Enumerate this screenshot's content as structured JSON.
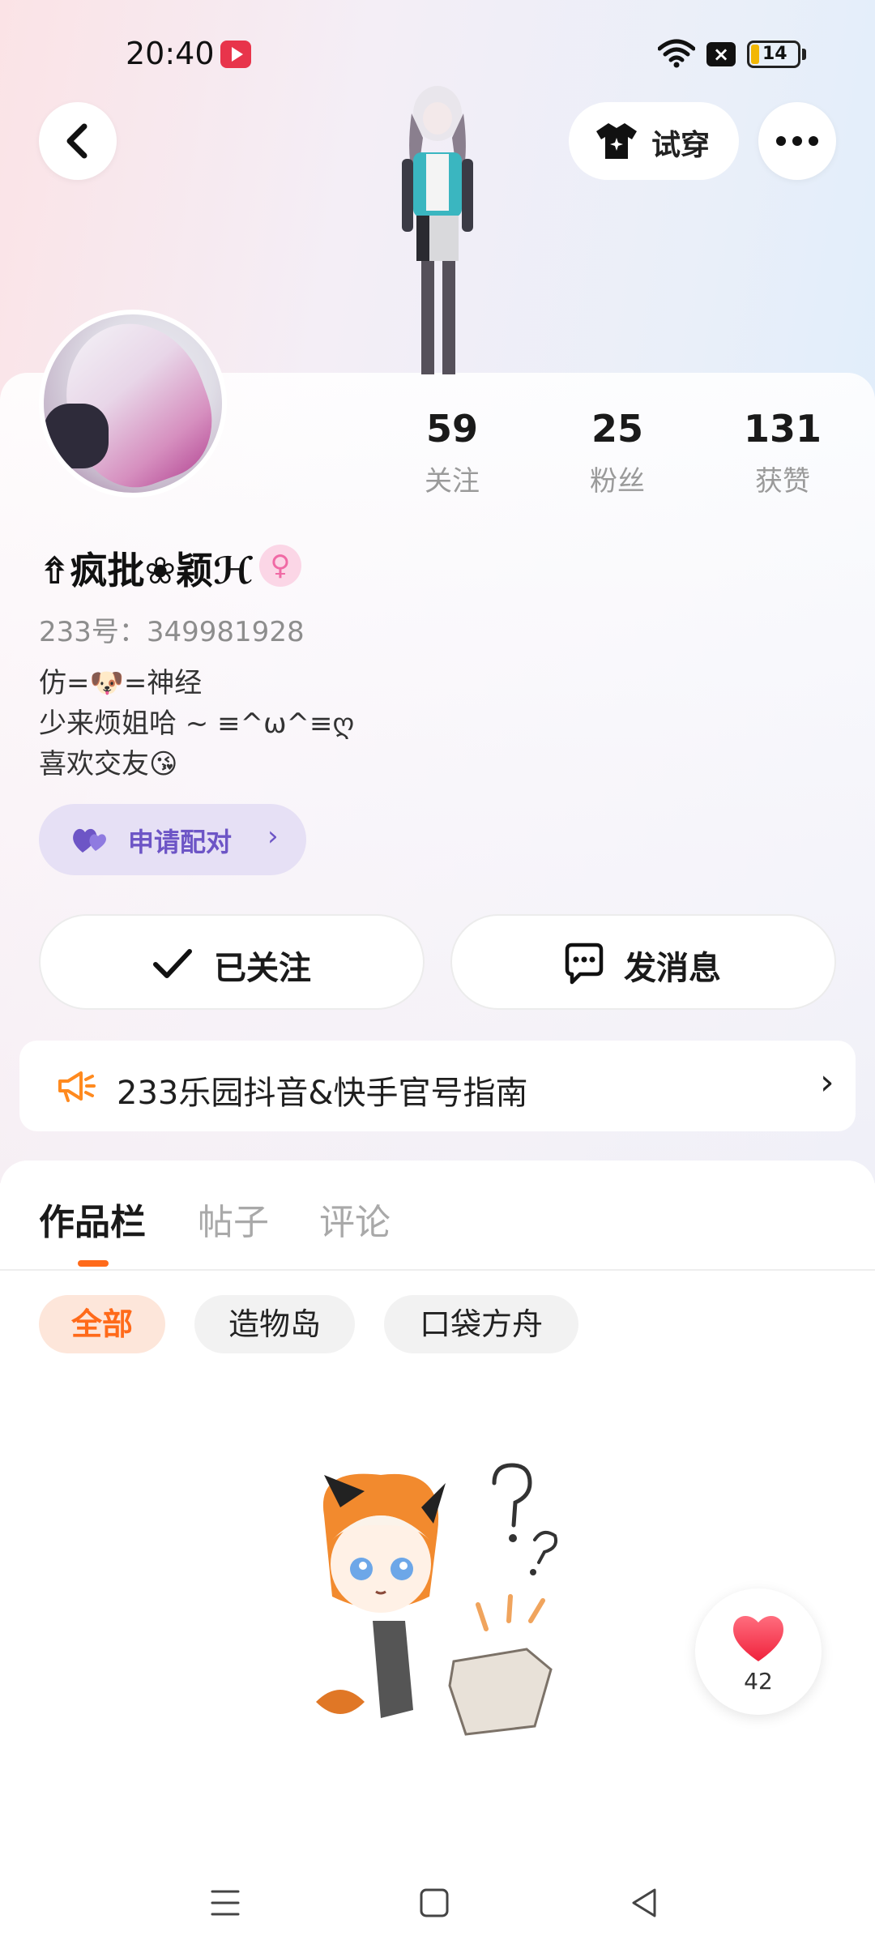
{
  "status_bar": {
    "time": "20:40",
    "battery": "14",
    "icons": [
      "record-icon",
      "wifi-icon",
      "no-sim-icon",
      "battery-icon"
    ]
  },
  "top_bar": {
    "try_on_label": "试穿",
    "icons": [
      "back-icon",
      "shirt-icon",
      "more-icon"
    ]
  },
  "stats": [
    {
      "value": "59",
      "label": "关注"
    },
    {
      "value": "25",
      "label": "粉丝"
    },
    {
      "value": "131",
      "label": "获赞"
    }
  ],
  "profile": {
    "name": "⇮疯批❀颖ℋ",
    "gender_symbol": "♀",
    "uid": "233号：349981928",
    "bio": "仿=🐶=神经\n少来烦姐哈 ~ ≡^ω^≡ღ\n喜欢交友😘"
  },
  "pair_button": {
    "label": "申请配对",
    "chevron": "›"
  },
  "actions": {
    "follow_label": "已关注",
    "message_label": "发消息"
  },
  "notice": {
    "text": "233乐园抖音&快手官号指南",
    "chevron": "›"
  },
  "tabs": [
    {
      "label": "作品栏",
      "active": true
    },
    {
      "label": "帖子",
      "active": false
    },
    {
      "label": "评论",
      "active": false
    }
  ],
  "filters": [
    {
      "label": "全部",
      "active": true
    },
    {
      "label": "造物岛",
      "active": false
    },
    {
      "label": "口袋方舟",
      "active": false
    }
  ],
  "like_float": {
    "count": "42"
  },
  "colors": {
    "accent_orange": "#ff6a1a",
    "pair_purple": "#6d55c6",
    "heart_red": "#ff3b4e"
  }
}
